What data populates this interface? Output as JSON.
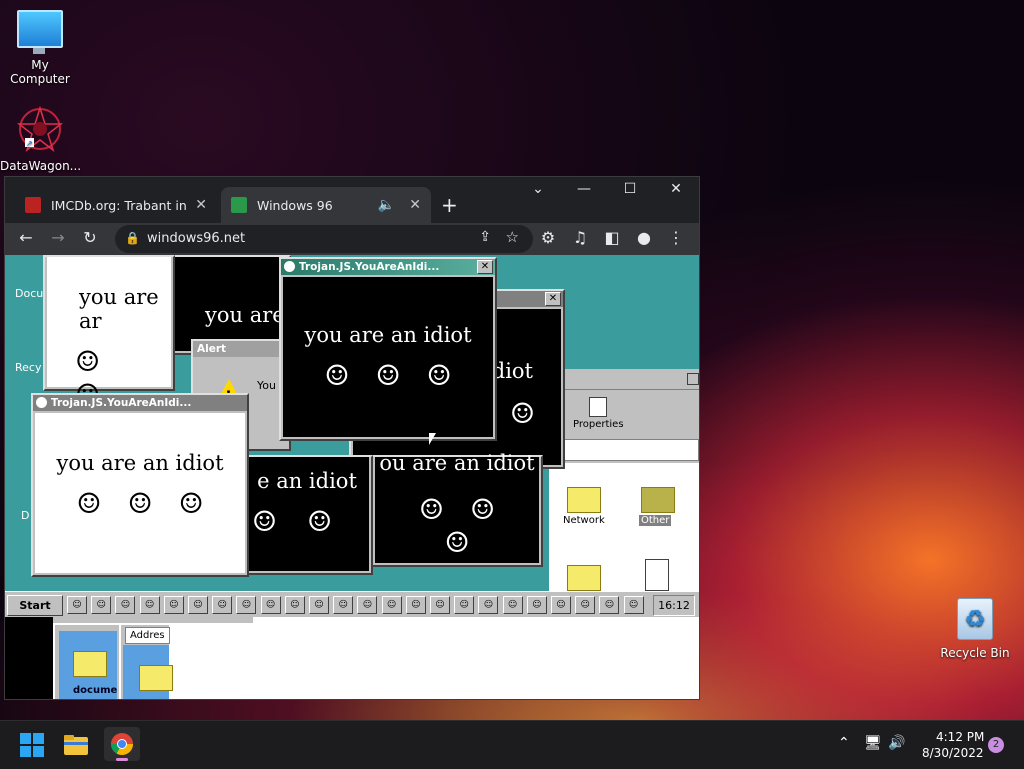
{
  "desktop": {
    "icons": [
      {
        "label": "My Computer"
      },
      {
        "label": "DataWagon..."
      },
      {
        "label": "Recycle Bin"
      }
    ]
  },
  "browser": {
    "tabs": [
      {
        "title": "IMCDb.org: Trabant in mov",
        "active": false
      },
      {
        "title": "Windows 96",
        "active": true
      }
    ],
    "url": "windows96.net",
    "window_controls": [
      "chevron-down",
      "minimize",
      "maximize",
      "close"
    ]
  },
  "win96": {
    "start_label": "Start",
    "clock": "16:12",
    "popup_title": "Trojan.JS.YouAreAnIdi...",
    "popup_text": "you are an idiot",
    "popup_text_partial_1": "you are ar",
    "popup_text_partial_2": "you are",
    "popup_text_partial_3": "e an idiot",
    "popup_text_partial_4": "idiot",
    "popup_text_partial_5": "ou are an idiot",
    "smileys": "☺☺☺",
    "alert_title": "Alert",
    "alert_text": "You",
    "explorer": {
      "properties_label": "Properties",
      "network_label": "Network",
      "other_label": "Other",
      "address_label": "Addres",
      "folder_label": "docume"
    },
    "side_labels": [
      "Docu",
      "Recy",
      "D"
    ]
  },
  "taskbar": {
    "time": "4:12 PM",
    "date": "8/30/2022",
    "notification_count": "2"
  }
}
